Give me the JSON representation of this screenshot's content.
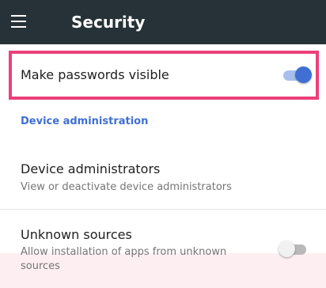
{
  "appbar": {
    "menu_icon": "hamburger-menu-icon",
    "title": "Security"
  },
  "settings": {
    "make_passwords_visible": {
      "label": "Make passwords visible",
      "toggle_state": "on"
    },
    "section_header": "Device administration",
    "device_administrators": {
      "title": "Device administrators",
      "summary": "View or deactivate device administrators"
    },
    "unknown_sources": {
      "title": "Unknown sources",
      "summary": "Allow installation of apps from unknown sources",
      "toggle_state": "off"
    }
  },
  "colors": {
    "appbar": "#263238",
    "accent": "#3f6fd3",
    "highlight": "#ec407a"
  }
}
